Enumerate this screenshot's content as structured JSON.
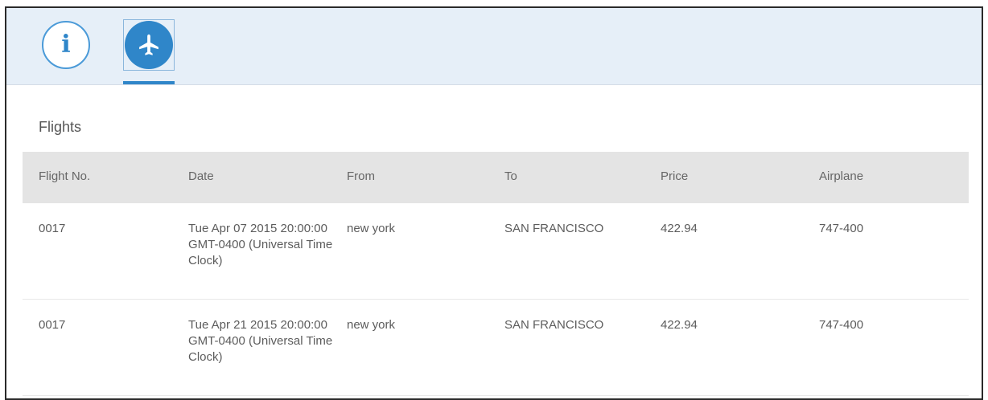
{
  "tabs": [
    {
      "icon": "info-icon",
      "glyph": "i",
      "selected": false
    },
    {
      "icon": "airplane-icon",
      "selected": true
    }
  ],
  "colors": {
    "accent": "#2f86c9",
    "header_bg": "#e6eff8",
    "table_header_bg": "#e4e4e4"
  },
  "section": {
    "title": "Flights"
  },
  "table": {
    "headers": [
      "Flight No.",
      "Date",
      "From",
      "To",
      "Price",
      "Airplane"
    ],
    "rows": [
      {
        "flight_no": "0017",
        "date": "Tue Apr 07 2015 20:00:00 GMT-0400 (Universal Time Clock)",
        "from": "new york",
        "to": "SAN FRANCISCO",
        "price": "422.94",
        "airplane": "747-400"
      },
      {
        "flight_no": "0017",
        "date": "Tue Apr 21 2015 20:00:00 GMT-0400 (Universal Time Clock)",
        "from": "new york",
        "to": "SAN FRANCISCO",
        "price": "422.94",
        "airplane": "747-400"
      }
    ]
  }
}
